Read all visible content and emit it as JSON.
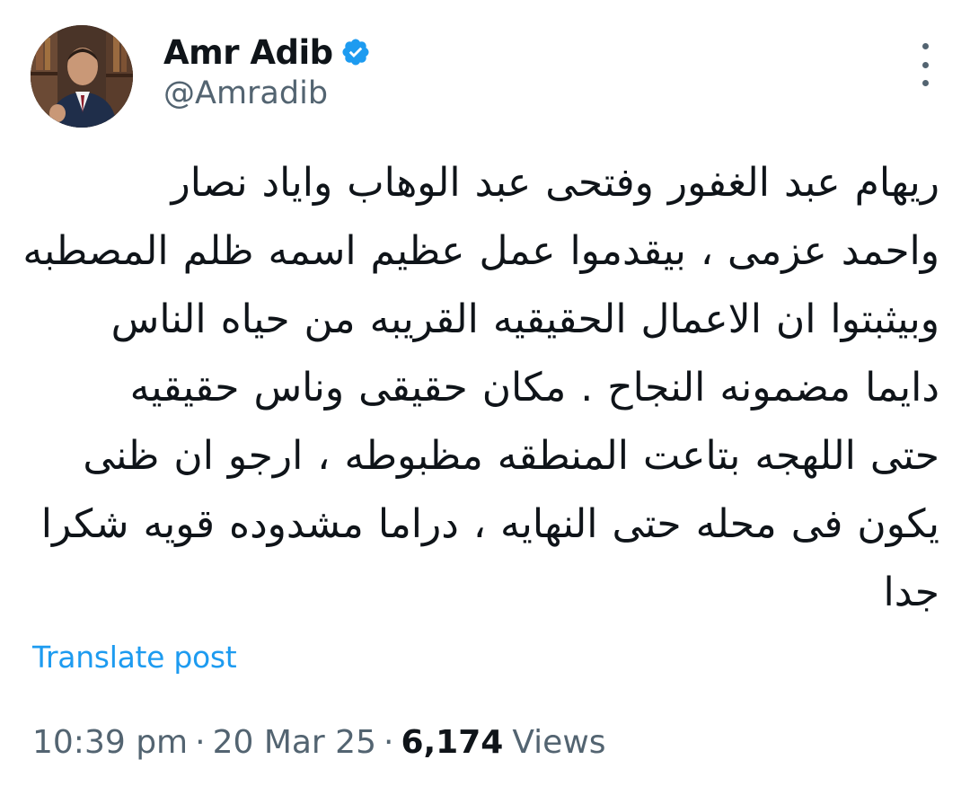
{
  "author": {
    "display_name": "Amr Adib",
    "handle": "@Amradib",
    "verified": true,
    "avatar_icon": "profile-photo"
  },
  "tweet": {
    "lines": [
      "ريهام عبد الغفور وفتحى عبد الوهاب واياد نصار",
      "واحمد عزمى ، بيقدموا عمل عظيم اسمه ظلم المصطبه",
      "وبيثبتوا ان الاعمال الحقيقيه القريبه من حياه الناس",
      "دايما مضمونه النجاح . مكان حقيقى وناس حقيقيه",
      "حتى اللهجه بتاعت المنطقه مظبوطه ، ارجو ان ظنى",
      "يكون فى محله حتى النهايه ، دراما مشدوده قويه شكرا",
      "جدا"
    ]
  },
  "actions": {
    "translate_label": "Translate post",
    "more_icon": "more-vertical-icon"
  },
  "meta": {
    "time": "10:39 pm",
    "separator": "·",
    "date": "20 Mar 25",
    "views_count": "6,174",
    "views_label": "Views"
  },
  "colors": {
    "text": "#0f1419",
    "secondary": "#536471",
    "accent": "#1d9bf0"
  }
}
